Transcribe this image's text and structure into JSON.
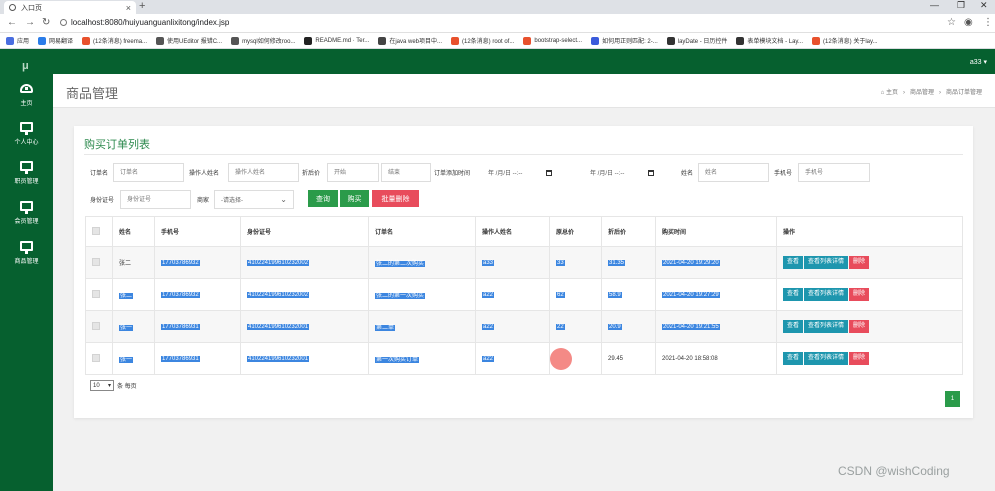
{
  "browser": {
    "tab_title": "入口页",
    "tab_close": "×",
    "new_tab": "+",
    "url": "localhost:8080/huiyuanguanlixitong/index.jsp",
    "bookmarks": [
      {
        "label": "应用",
        "color": "#4a6ee0"
      },
      {
        "label": "网易翻译",
        "color": "#2b7de9"
      },
      {
        "label": "(12条消息) freema...",
        "color": "#e8512d"
      },
      {
        "label": "使用UEditor 报错C...",
        "color": "#555555"
      },
      {
        "label": "mysql如何修改roo...",
        "color": "#555555"
      },
      {
        "label": "README.md · Ter...",
        "color": "#222222"
      },
      {
        "label": "在java web项目中...",
        "color": "#444444"
      },
      {
        "label": "(12条消息) root of...",
        "color": "#e8512d"
      },
      {
        "label": "bootstrap-select...",
        "color": "#e8512d"
      },
      {
        "label": "如何用正则匹配: 2-...",
        "color": "#3b5bdb"
      },
      {
        "label": "layDate - 日历控件",
        "color": "#333333"
      },
      {
        "label": "表单模块文档 - Lay...",
        "color": "#333333"
      },
      {
        "label": "(12条消息) 关于lay...",
        "color": "#e8512d"
      }
    ]
  },
  "app": {
    "logo": "μ",
    "user": "a33 ▾",
    "sidebar": [
      {
        "label": "主页",
        "icon": "dashboard-icon"
      },
      {
        "label": "个人中心",
        "icon": "monitor-icon"
      },
      {
        "label": "职员管理",
        "icon": "monitor-icon"
      },
      {
        "label": "会员管理",
        "icon": "monitor-icon"
      },
      {
        "label": "商品管理",
        "icon": "monitor-icon"
      }
    ],
    "page_title": "商品管理",
    "breadcrumb": [
      "主页",
      "商品管理",
      "商品订单管理"
    ]
  },
  "panel": {
    "title": "购买订单列表",
    "filters": {
      "order_name_label": "订单名",
      "order_name_placeholder": "订单名",
      "operator_label": "操作人姓名",
      "operator_placeholder": "操作人姓名",
      "discount_label": "折后价",
      "discount_start_placeholder": "开始",
      "discount_end_placeholder": "结束",
      "add_time_label": "订单添加时间",
      "date_start": "年 /月/日 --:--",
      "date_end": "年 /月/日 --:--",
      "name_label": "姓名",
      "name_placeholder": "姓名",
      "phone_label": "手机号",
      "phone_placeholder": "手机号",
      "id_label": "身份证号",
      "id_placeholder": "身份证号",
      "shop_label": "商家",
      "shop_value": "-请选择-"
    },
    "buttons": {
      "search": "查询",
      "buy": "购买",
      "batch_delete": "批量删除"
    },
    "table": {
      "headers": [
        "",
        "姓名",
        "手机号",
        "身份证号",
        "订单名",
        "操作人姓名",
        "原总价",
        "折后价",
        "购买时间",
        "操作"
      ],
      "rows": [
        {
          "name": "张二",
          "phone": "17703786932",
          "id": "410224199610232002",
          "order": "张二的第二次购买",
          "operator": "a33",
          "orig": "33",
          "disc": "31.35",
          "time": "2021-04-20 19:29:20"
        },
        {
          "name": "张二",
          "phone": "17703786932",
          "id": "410224199610232002",
          "order": "张二的第一次购买",
          "operator": "a22",
          "orig": "62",
          "disc": "58.9",
          "time": "2021-04-20 19:27:29"
        },
        {
          "name": "张一",
          "phone": "17703786931",
          "id": "410224199610232001",
          "order": "第二单",
          "operator": "a22",
          "orig": "22",
          "disc": "20.9",
          "time": "2021-04-20 19:21:55"
        },
        {
          "name": "张一",
          "phone": "17703786931",
          "id": "410224199610232001",
          "order": "第一次购买订单",
          "operator": "a22",
          "orig": "",
          "disc": "29.45",
          "time": "2021-04-20 18:58:08"
        }
      ],
      "row_actions": {
        "view": "查看",
        "detail": "查看列表详情",
        "delete": "删除"
      }
    },
    "page_size": "10",
    "page_size_suffix": "条 每页",
    "current_page": "1"
  },
  "watermark": "CSDN @wishCoding"
}
